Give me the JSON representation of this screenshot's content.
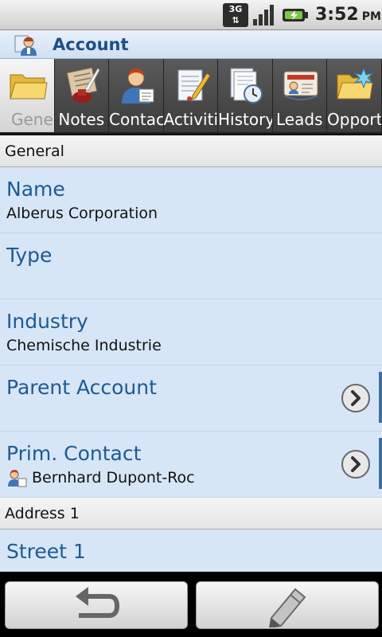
{
  "status_bar": {
    "network": "3G",
    "time": "3:52",
    "ampm": "PM"
  },
  "title_bar": {
    "title": "Account",
    "icon": "account-icon"
  },
  "tabs": [
    {
      "label": "General",
      "icon": "folder-icon",
      "active": true
    },
    {
      "label": "Notes",
      "icon": "notes-icon",
      "active": false
    },
    {
      "label": "Contacts",
      "icon": "contacts-icon",
      "active": false
    },
    {
      "label": "Activities",
      "icon": "activities-icon",
      "active": false
    },
    {
      "label": "History",
      "icon": "history-icon",
      "active": false
    },
    {
      "label": "Leads",
      "icon": "leads-icon",
      "active": false
    },
    {
      "label": "Opportunities",
      "icon": "opportunities-icon",
      "active": false
    }
  ],
  "sections": {
    "general": "General",
    "address": "Address 1"
  },
  "fields": {
    "name": {
      "label": "Name",
      "value": "Alberus Corporation"
    },
    "type": {
      "label": "Type",
      "value": ""
    },
    "industry": {
      "label": "Industry",
      "value": "Chemische Industrie"
    },
    "parent_account": {
      "label": "Parent Account",
      "value": ""
    },
    "prim_contact": {
      "label": "Prim. Contact",
      "value": "Bernhard Dupont-Roc"
    },
    "street1": {
      "label": "Street 1",
      "value": ""
    }
  },
  "bottom_bar": {
    "back_icon": "undo-icon",
    "edit_icon": "pencil-icon"
  },
  "colors": {
    "accent": "#1e5a92",
    "content_bg": "#d6e6f7",
    "title_bg": "#cfe0f3"
  }
}
